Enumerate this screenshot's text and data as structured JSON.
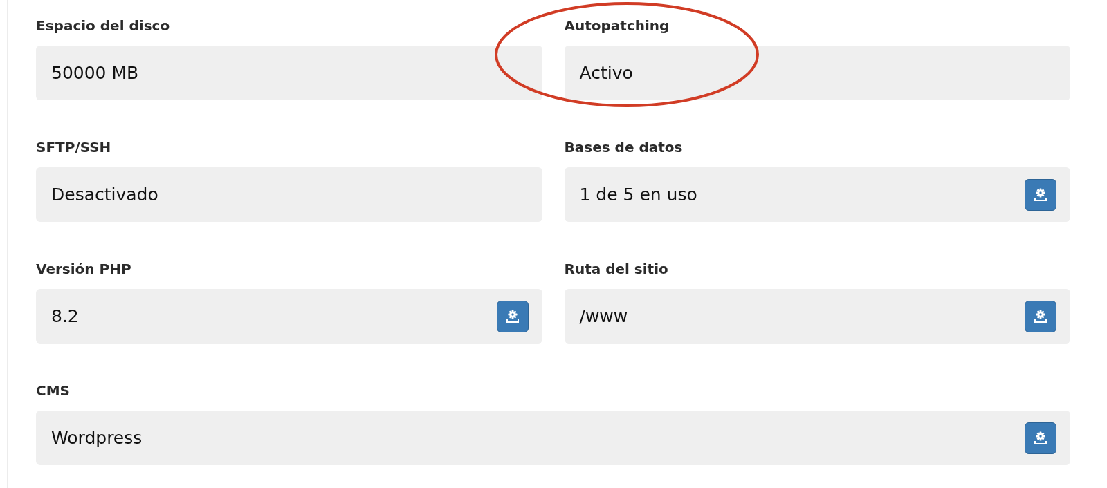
{
  "fields": [
    {
      "label": "Espacio del disco",
      "value": "50000 MB",
      "kind": "static",
      "wide": false,
      "highlighted": false
    },
    {
      "label": "Autopatching",
      "value": "Activo",
      "kind": "static",
      "wide": false,
      "highlighted": true
    },
    {
      "label": "SFTP/SSH",
      "value": "Desactivado",
      "kind": "static",
      "wide": false,
      "highlighted": false
    },
    {
      "label": "Bases de datos",
      "value": "1 de 5 en uso",
      "kind": "action",
      "wide": false,
      "highlighted": false
    },
    {
      "label": "Versión PHP",
      "value": "8.2",
      "kind": "action",
      "wide": false,
      "highlighted": false
    },
    {
      "label": "Ruta del sitio",
      "value": "/www",
      "kind": "action",
      "wide": false,
      "highlighted": false
    },
    {
      "label": "CMS",
      "value": "Wordpress",
      "kind": "action",
      "wide": true,
      "highlighted": false
    }
  ]
}
